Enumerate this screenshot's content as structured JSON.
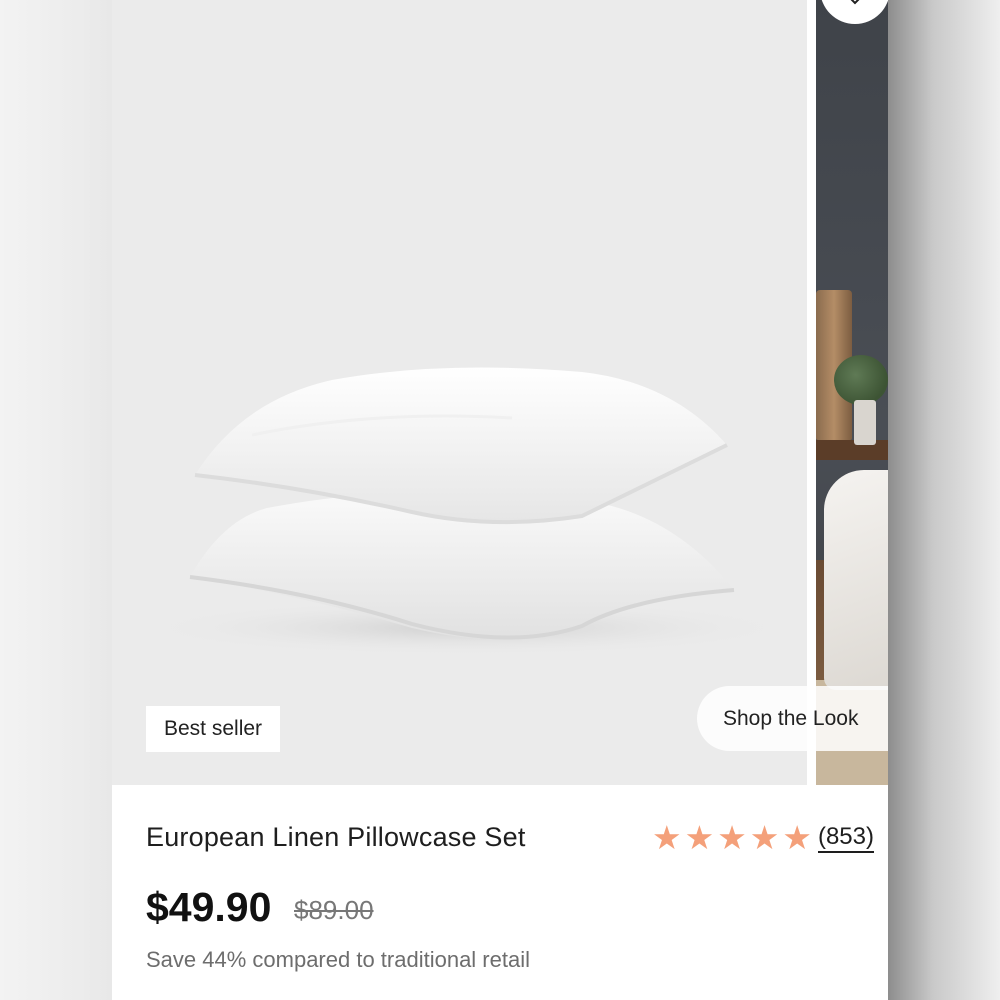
{
  "product": {
    "badge": "Best seller",
    "shop_look_label": "Shop the Look",
    "title": "European Linen Pillowcase Set",
    "rating": {
      "stars": 5,
      "review_count": "(853)"
    },
    "price": "$49.90",
    "original_price": "$89.00",
    "savings": "Save 44% compared to traditional retail"
  },
  "icons": {
    "favorite": "heart-icon",
    "star": "star-icon"
  },
  "colors": {
    "star": "#f4a07a",
    "image_background": "#ebebeb"
  }
}
